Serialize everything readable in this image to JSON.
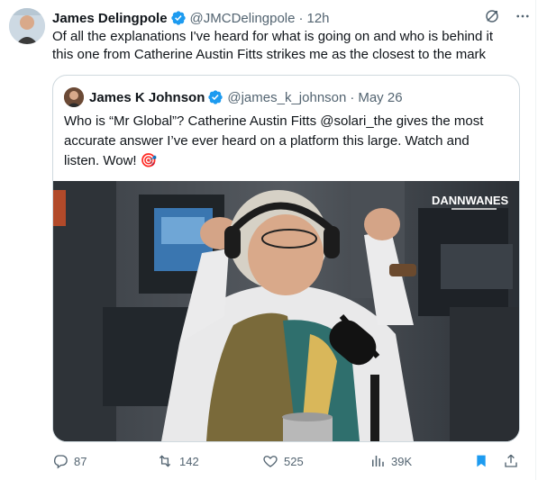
{
  "tweet": {
    "author_name": "James Delingpole",
    "author_handle": "@JMCDelingpole",
    "separator": "·",
    "time": "12h",
    "text": "Of all the explanations I've heard for what is going on and who is behind it this one from Catherine Austin Fitts strikes me as the closest to the mark"
  },
  "quoted": {
    "author_name": "James K Johnson",
    "author_handle": "@james_k_johnson",
    "separator": "·",
    "date": "May 26",
    "text": "Who is “Mr Global”? Catherine Austin Fitts @solari_the gives the most accurate answer I’ve ever heard on a platform this large. Watch and listen. Wow! 🎯",
    "video_watermark": "DANNWANES"
  },
  "actions": {
    "replies": "87",
    "retweets": "142",
    "likes": "525",
    "views": "39K"
  },
  "colors": {
    "verified": "#1d9bf0",
    "secondary_text": "#536471",
    "bookmark_active": "#1d9bf0",
    "border": "#cfd9de"
  },
  "icons": [
    "grok-icon",
    "more-icon",
    "reply-icon",
    "retweet-icon",
    "like-icon",
    "views-icon",
    "bookmark-icon",
    "share-icon"
  ]
}
